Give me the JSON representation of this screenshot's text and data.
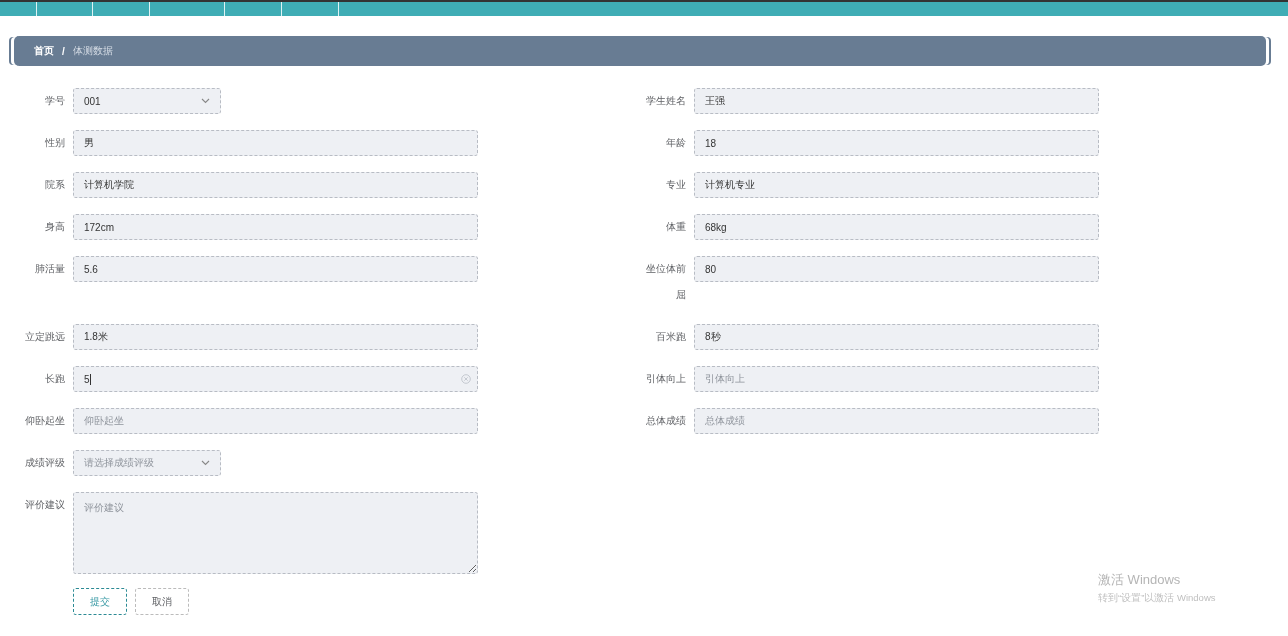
{
  "breadcrumb": {
    "home": "首页",
    "separator": "/",
    "current": "体测数据"
  },
  "rows": [
    [
      {
        "kind": "select",
        "label": "学号",
        "value": "001"
      },
      {
        "kind": "input",
        "label": "学生姓名",
        "value": "王强"
      }
    ],
    [
      {
        "kind": "input",
        "label": "性别",
        "value": "男"
      },
      {
        "kind": "input",
        "label": "年龄",
        "value": "18"
      }
    ],
    [
      {
        "kind": "input",
        "label": "院系",
        "value": "计算机学院"
      },
      {
        "kind": "input",
        "label": "专业",
        "value": "计算机专业"
      }
    ],
    [
      {
        "kind": "input",
        "label": "身高",
        "value": "172cm"
      },
      {
        "kind": "input",
        "label": "体重",
        "value": "68kg"
      }
    ],
    [
      {
        "kind": "input",
        "label": "肺活量",
        "value": "5.6"
      },
      {
        "kind": "input",
        "label": "坐位体前屈",
        "value": "80"
      }
    ],
    [
      {
        "kind": "input",
        "label": "立定跳远",
        "value": "1.8米"
      },
      {
        "kind": "input",
        "label": "百米跑",
        "value": "8秒"
      }
    ],
    [
      {
        "kind": "input",
        "label": "长跑",
        "value": "5",
        "focused": true
      },
      {
        "kind": "input",
        "label": "引体向上",
        "placeholder": "引体向上"
      }
    ],
    [
      {
        "kind": "input",
        "label": "仰卧起坐",
        "placeholder": "仰卧起坐"
      },
      {
        "kind": "input",
        "label": "总体成绩",
        "placeholder": "总体成绩"
      }
    ],
    [
      {
        "kind": "select",
        "label": "成绩评级",
        "placeholder": "请选择成绩评级"
      }
    ],
    [
      {
        "kind": "textarea",
        "label": "评价建议",
        "placeholder": "评价建议"
      }
    ]
  ],
  "buttons": [
    {
      "label": "提交",
      "kind": "primary"
    },
    {
      "label": "取消",
      "kind": "default"
    }
  ],
  "windows_notice": {
    "title": "激活 Windows",
    "text": "转到“设置”以激活 Windows"
  }
}
